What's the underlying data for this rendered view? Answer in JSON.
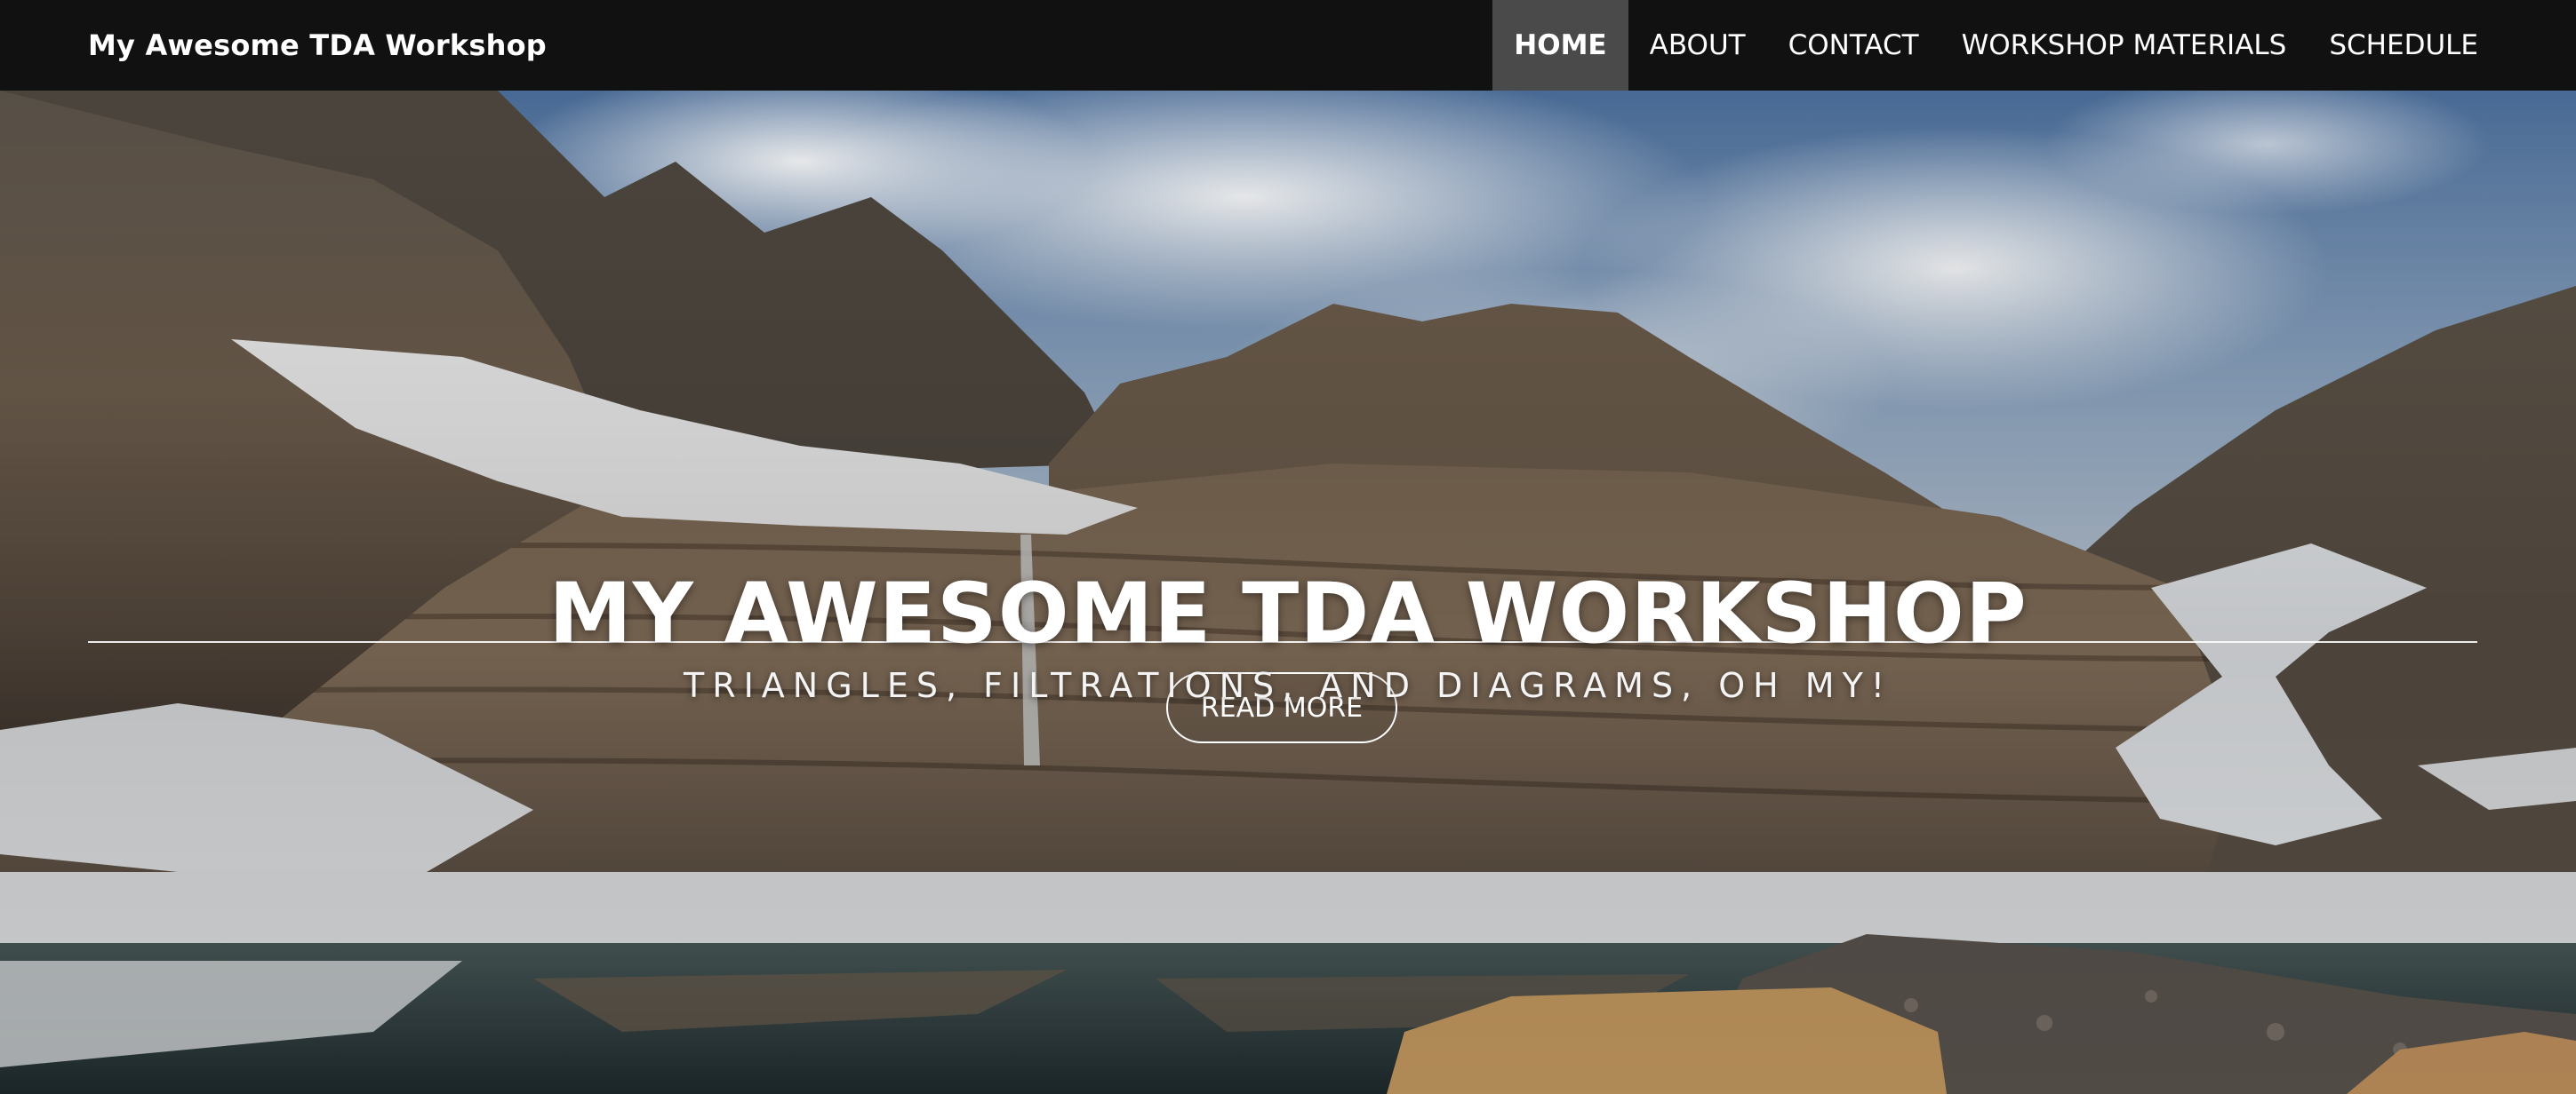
{
  "header": {
    "brand": "My Awesome TDA Workshop",
    "nav": [
      {
        "label": "HOME",
        "active": true
      },
      {
        "label": "ABOUT",
        "active": false
      },
      {
        "label": "CONTACT",
        "active": false
      },
      {
        "label": "WORKSHOP MATERIALS",
        "active": false
      },
      {
        "label": "SCHEDULE",
        "active": false
      }
    ]
  },
  "hero": {
    "title": "MY AWESOME TDA WORKSHOP",
    "subtitle": "TRIANGLES, FILTRATIONS, AND DIAGRAMS, OH MY!",
    "button_label": "READ MORE"
  },
  "colors": {
    "navbar_bg": "#111111",
    "active_tab_bg": "#4a4a4a",
    "text": "#ffffff"
  }
}
